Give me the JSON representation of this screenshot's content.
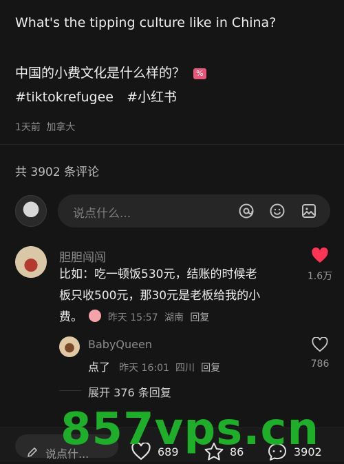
{
  "post": {
    "line_en": "What's the tipping culture like in China?",
    "line_zh": "中国的小费文化是什么样的？",
    "emoji_label": "%",
    "tag1": "#tiktokrefugee",
    "tag2": "#小红书",
    "meta_time": "1天前",
    "meta_location": "加拿大"
  },
  "comments_header": {
    "count_text": "共 3902 条评论"
  },
  "comment_input": {
    "placeholder": "说点什么..."
  },
  "comment": {
    "author": "胆胆闯闯",
    "line1": "比如：吃一顿饭530元，结账的时候老",
    "line2": "板只收500元，那30元是老板给我的小",
    "line3": "费。",
    "time": "昨天 15:57",
    "location": "湖南",
    "reply_label": "回复",
    "likes": "1.6万",
    "liked_color": "#ff3355"
  },
  "reply": {
    "author": "BabyQueen",
    "text": "点了",
    "time": "昨天 16:01",
    "location": "四川",
    "reply_label": "回复",
    "likes": "786"
  },
  "expand": {
    "label": "展开 376 条回复"
  },
  "bottom_bar": {
    "input_placeholder": "说点什...",
    "likes": "689",
    "stars": "86",
    "comments": "3902"
  },
  "watermark": {
    "text": "857vps.cn",
    "color": "#1fae2a"
  }
}
